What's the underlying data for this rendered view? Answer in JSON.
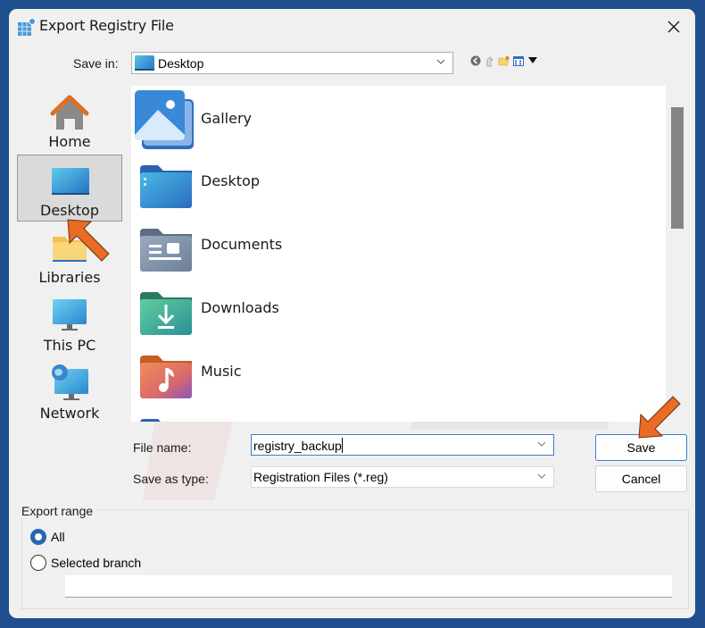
{
  "window": {
    "title": "Export Registry File",
    "close_icon": "close-icon"
  },
  "save_in": {
    "label": "Save in:",
    "value": "Desktop",
    "icon": "desktop-icon",
    "toolbar": [
      {
        "name": "back-icon",
        "glyph": "◀"
      },
      {
        "name": "up-folder-icon",
        "glyph": "↑"
      },
      {
        "name": "new-folder-icon",
        "glyph": "+"
      },
      {
        "name": "view-menu-icon",
        "glyph": "▦"
      },
      {
        "name": "view-dropdown-icon",
        "glyph": "▼"
      }
    ]
  },
  "places": [
    {
      "label": "Home",
      "icon": "home-icon",
      "selected": false
    },
    {
      "label": "Desktop",
      "icon": "desktop-icon",
      "selected": true
    },
    {
      "label": "Libraries",
      "icon": "libraries-icon",
      "selected": false
    },
    {
      "label": "This PC",
      "icon": "this-pc-icon",
      "selected": false
    },
    {
      "label": "Network",
      "icon": "network-icon",
      "selected": false
    }
  ],
  "files": [
    {
      "label": "Gallery",
      "icon": "gallery-icon"
    },
    {
      "label": "Desktop",
      "icon": "desktop-folder-icon"
    },
    {
      "label": "Documents",
      "icon": "documents-folder-icon"
    },
    {
      "label": "Downloads",
      "icon": "downloads-folder-icon"
    },
    {
      "label": "Music",
      "icon": "music-folder-icon"
    }
  ],
  "form": {
    "file_name_label": "File name:",
    "file_name_value": "registry_backup",
    "save_type_label": "Save as type:",
    "save_type_value": "Registration Files (*.reg)"
  },
  "buttons": {
    "save": "Save",
    "cancel": "Cancel"
  },
  "export_range": {
    "title": "Export range",
    "options": [
      {
        "label": "All",
        "checked": true
      },
      {
        "label": "Selected branch",
        "checked": false
      }
    ],
    "branch_value": ""
  },
  "colors": {
    "accent": "#2a63b5",
    "annotation_arrow": "#ea6b23",
    "desktop_bg": "#1f4f8f"
  }
}
